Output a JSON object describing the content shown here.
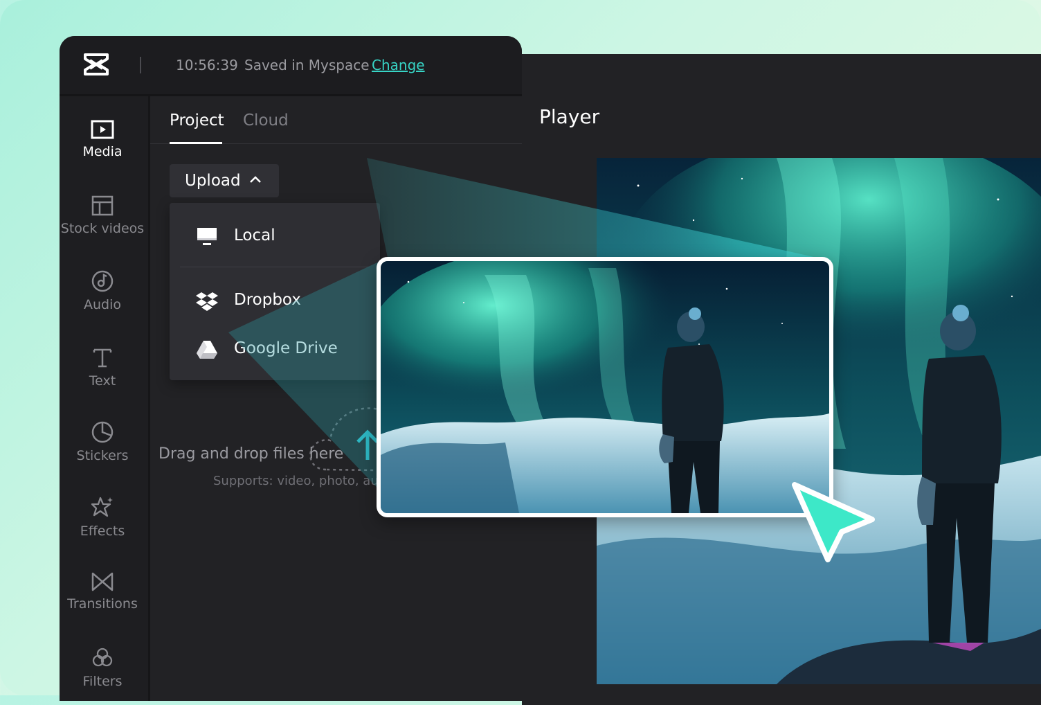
{
  "app": {
    "logo": "capcut-logo-icon",
    "save_time": "10:56:39",
    "save_status": "Saved in Myspace",
    "change_link": "Change"
  },
  "sidebar": {
    "items": [
      {
        "label": "Media",
        "icon": "media-play-icon",
        "active": true
      },
      {
        "label": "Stock videos",
        "icon": "layout-grid-icon",
        "active": false
      },
      {
        "label": "Audio",
        "icon": "music-note-icon",
        "active": false
      },
      {
        "label": "Text",
        "icon": "text-t-icon",
        "active": false
      },
      {
        "label": "Stickers",
        "icon": "sticker-icon",
        "active": false
      },
      {
        "label": "Effects",
        "icon": "sparkle-star-icon",
        "active": false
      },
      {
        "label": "Transitions",
        "icon": "bowtie-transition-icon",
        "active": false
      },
      {
        "label": "Filters",
        "icon": "filters-circles-icon",
        "active": false
      }
    ]
  },
  "tabs": [
    {
      "label": "Project",
      "active": true
    },
    {
      "label": "Cloud",
      "active": false
    }
  ],
  "upload": {
    "label": "Upload",
    "menu": [
      {
        "label": "Local",
        "icon": "monitor-icon"
      },
      {
        "label": "Dropbox",
        "icon": "dropbox-icon"
      },
      {
        "label": "Google Drive",
        "icon": "google-drive-icon"
      }
    ]
  },
  "dropzone": {
    "text": "Drag and drop files here",
    "supports": "Supports: video, photo, audio"
  },
  "player": {
    "title": "Player"
  },
  "colors": {
    "accent": "#37d5c6",
    "cursor": "#3de8c8",
    "panel": "#222225"
  }
}
